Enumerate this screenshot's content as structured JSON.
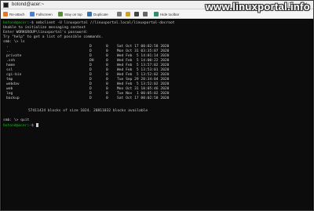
{
  "window": {
    "title": "botond@acer:~",
    "icon": "terminal-icon",
    "controls": [
      "minimize-icon",
      "maximize-icon",
      "close-icon"
    ]
  },
  "toolbar": {
    "items": [
      {
        "label": "Re-attach",
        "icon": "reattach-icon"
      },
      {
        "label": "Fullscreen",
        "icon": "fullscreen-icon"
      },
      {
        "label": "Stay on top",
        "icon": "pin-icon"
      },
      {
        "label": "Duplicate",
        "icon": "duplicate-icon"
      },
      {
        "label": "",
        "icon": "settings-icon"
      },
      {
        "label": "",
        "icon": "event-log-icon"
      },
      {
        "label": "",
        "icon": "keyboard-icon"
      },
      {
        "label": "",
        "icon": "mouse-icon"
      },
      {
        "label": "Hide toolbar",
        "icon": "hide-toolbar-icon"
      }
    ]
  },
  "watermark": "www.linuxportal.info",
  "terminal": {
    "prompt_user": "botond@acer",
    "prompt_path": "~",
    "command": "smbclient -U linuxportal //linuxportal.local/linuxportal-docroot",
    "messages": [
      "Unable to initialize messaging context",
      "Enter WORKGROUP\\linuxportal's password:",
      "Try \"help\" to get a list of possible commands."
    ],
    "smb_prompt": "smb: \\>",
    "ls_command": "ls",
    "listing": [
      {
        "name": ".",
        "attr": "D",
        "size": "0",
        "date": "Sat Oct 17 00:02:58 2020"
      },
      {
        "name": "..",
        "attr": "D",
        "size": "0",
        "date": "Mon Oct 31 03:35:07 2020"
      },
      {
        "name": "private",
        "attr": "D",
        "size": "0",
        "date": "Wed Feb  5 14:01:14 2020"
      },
      {
        "name": ".ssh",
        "attr": "DH",
        "size": "0",
        "date": "Wed Feb  5 14:00:22 2020"
      },
      {
        "name": "home",
        "attr": "D",
        "size": "0",
        "date": "Wed Feb  5 13:57:02 2020"
      },
      {
        "name": "ssl",
        "attr": "D",
        "size": "0",
        "date": "Wed Feb  5 13:53:01 2020"
      },
      {
        "name": "cgi-bin",
        "attr": "D",
        "size": "0",
        "date": "Wed Feb  5 13:52:02 2020"
      },
      {
        "name": "tmp",
        "attr": "D",
        "size": "0",
        "date": "Tue Sep 29 20:34:04 2020"
      },
      {
        "name": "webdav",
        "attr": "D",
        "size": "0",
        "date": "Wed Feb  5 13:52:02 2020"
      },
      {
        "name": "web",
        "attr": "D",
        "size": "0",
        "date": "Mon Oct 31 10:05:46 2020"
      },
      {
        "name": "log",
        "attr": "D",
        "size": "0",
        "date": "Tue Nov  1 00:05:02 2020"
      },
      {
        "name": "backup",
        "attr": "D",
        "size": "0",
        "date": "Sat Oct 17 00:02:58 2020"
      }
    ],
    "blocks_line": "57411424 blocks of size 1024. 20811032 blocks available",
    "quit_command": "quit",
    "colors": {
      "green": "#13c313",
      "blue": "#3b78ff",
      "text": "#cccccc",
      "background": "#0c0c0c"
    }
  }
}
